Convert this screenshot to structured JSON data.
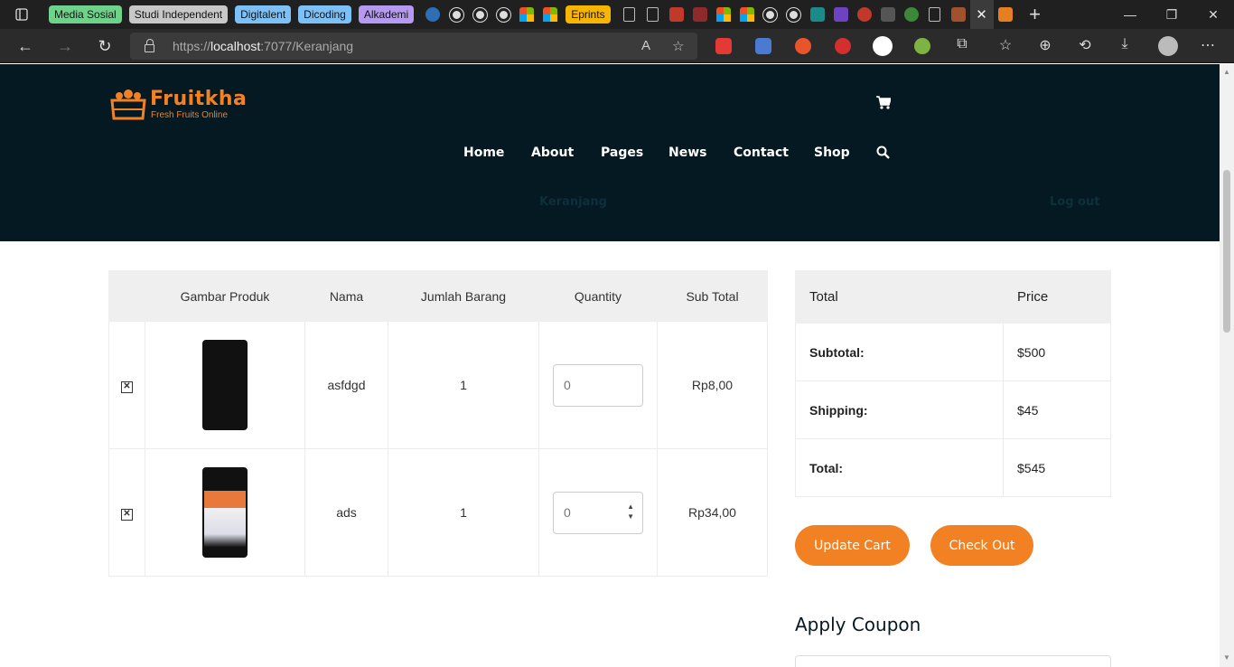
{
  "browser": {
    "tab_groups": [
      {
        "label": "Media Sosial",
        "color": "#6fd28b"
      },
      {
        "label": "Studi Independent",
        "color": "#c8c8c8"
      },
      {
        "label": "Digitalent",
        "color": "#7cc0f5"
      },
      {
        "label": "Dicoding",
        "color": "#7cc0f5"
      },
      {
        "label": "Alkademi",
        "color": "#b699f0"
      },
      {
        "label": "Eprints",
        "color": "#f7b500"
      }
    ],
    "url_host": "https://localhost",
    "url_rest": ":7077/Keranjang",
    "url_bold": "localhost"
  },
  "site": {
    "brand": "Fruitkha",
    "tagline": "Fresh Fruits Online",
    "brand_color": "#f28123",
    "header_bg": "#051922",
    "nav": [
      "Home",
      "About",
      "Pages",
      "News",
      "Contact",
      "Shop"
    ],
    "sub_links": {
      "cart": "Keranjang",
      "logout": "Log out"
    }
  },
  "cart": {
    "headers": [
      "",
      "Gambar Produk",
      "Nama",
      "Jumlah Barang",
      "Quantity",
      "Sub Total"
    ],
    "rows": [
      {
        "name": "asfdgd",
        "jumlah": "1",
        "qty_placeholder": "0",
        "subtotal": "Rp8,00"
      },
      {
        "name": "ads",
        "jumlah": "1",
        "qty_placeholder": "0",
        "subtotal": "Rp34,00"
      }
    ]
  },
  "totals": {
    "headers": [
      "Total",
      "Price"
    ],
    "rows": [
      {
        "label": "Subtotal:",
        "value": "$500"
      },
      {
        "label": "Shipping:",
        "value": "$45"
      },
      {
        "label": "Total:",
        "value": "$545"
      }
    ]
  },
  "actions": {
    "update": "Update Cart",
    "checkout": "Check Out"
  },
  "coupon": {
    "title": "Apply Coupon"
  }
}
